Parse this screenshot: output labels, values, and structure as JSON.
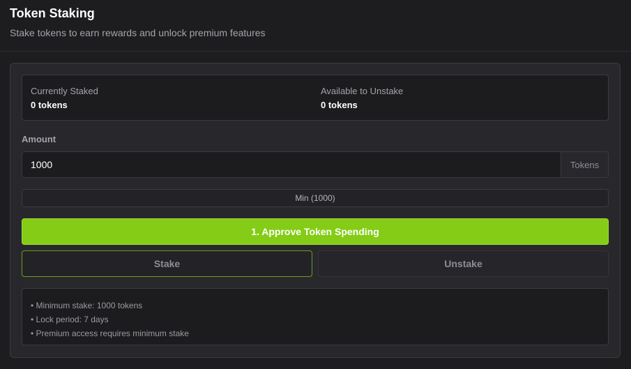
{
  "header": {
    "title": "Token Staking",
    "subtitle": "Stake tokens to earn rewards and unlock premium features"
  },
  "stats": {
    "staked_label": "Currently Staked",
    "staked_value": "0 tokens",
    "available_label": "Available to Unstake",
    "available_value": "0 tokens"
  },
  "amount": {
    "label": "Amount",
    "value": "1000",
    "unit": "Tokens"
  },
  "buttons": {
    "min": "Min (1000)",
    "approve": "1. Approve Token Spending",
    "stake": "Stake",
    "unstake": "Unstake"
  },
  "info": [
    "• Minimum stake: 1000 tokens",
    "• Lock period: 7 days",
    "• Premium access requires minimum stake"
  ],
  "colors": {
    "accent": "#84cc16",
    "background": "#1d1d20",
    "card": "#28282c"
  }
}
